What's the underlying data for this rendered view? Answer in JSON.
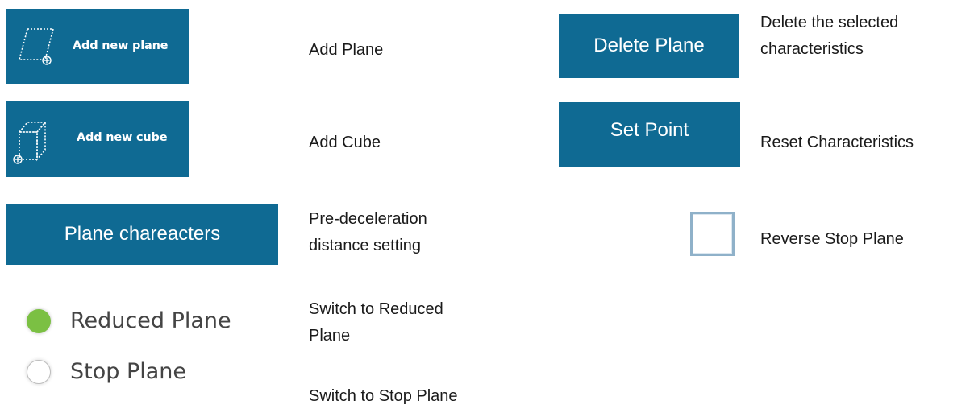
{
  "buttons": {
    "add_plane_label": "Add new plane",
    "add_cube_label": "Add new cube",
    "plane_characters_label": "Plane chareacters",
    "delete_plane_label": "Delete Plane",
    "set_point_label": "Set Point"
  },
  "descriptions": {
    "add_plane": "Add Plane",
    "add_cube": "Add Cube",
    "pre_decel_line1": "Pre-deceleration",
    "pre_decel_line2": "distance setting",
    "switch_reduced_line1": "Switch to Reduced",
    "switch_reduced_line2": "Plane",
    "switch_stop": "Switch to Stop Plane",
    "delete_selected_line1": "Delete the selected",
    "delete_selected_line2": "characteristics",
    "reset_characteristics": "Reset Characteristics",
    "reverse_stop_plane": "Reverse Stop Plane"
  },
  "radios": {
    "reduced_plane": {
      "label": "Reduced Plane",
      "selected": true
    },
    "stop_plane": {
      "label": "Stop Plane",
      "selected": false
    }
  },
  "checkbox": {
    "checked": false
  },
  "icons": {
    "plane_icon": "plane-outline-add-icon",
    "cube_icon": "cube-outline-add-icon"
  },
  "colors": {
    "button_bg": "#0f6a93",
    "button_text": "#ffffff",
    "radio_selected": "#7bc043"
  }
}
